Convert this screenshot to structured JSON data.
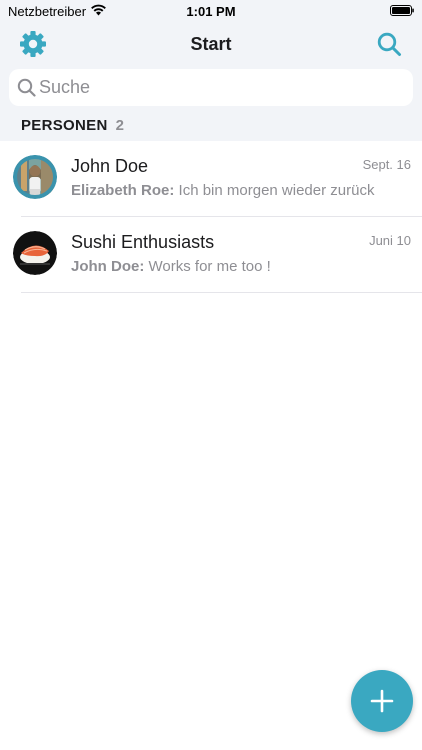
{
  "status_bar": {
    "carrier": "Netzbetreiber",
    "time": "1:01 PM"
  },
  "nav": {
    "title": "Start",
    "left_icon": "gear-icon",
    "right_icon": "search-icon"
  },
  "search": {
    "placeholder": "Suche",
    "value": ""
  },
  "section": {
    "title": "PERSONEN",
    "count": "2"
  },
  "chats": [
    {
      "name": "John Doe",
      "date": "Sept. 16",
      "sender": "Elizabeth Roe:",
      "message": " Ich bin morgen wieder zurück"
    },
    {
      "name": "Sushi Enthusiasts",
      "date": "Juni 10",
      "sender": "John Doe:",
      "message": " Works for me too !"
    }
  ],
  "fab": {
    "icon": "plus-icon"
  },
  "colors": {
    "accent": "#3aa8c1",
    "top_background": "#f2f4f8",
    "secondary_text": "#8e8e93"
  }
}
